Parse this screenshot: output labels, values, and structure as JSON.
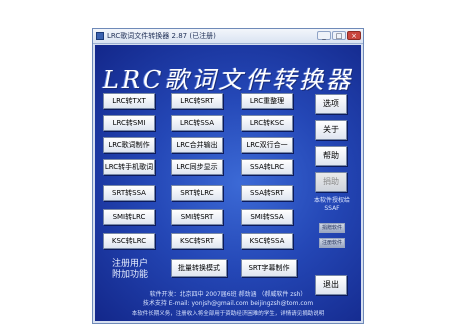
{
  "window": {
    "title": "LRC歌词文件转换器 2.87 (已注册)"
  },
  "logo_text": "LRC歌词文件转换器",
  "buttons": {
    "r1": [
      "LRC转TXT",
      "LRC转SRT",
      "LRC重整理"
    ],
    "r2": [
      "LRC转SMI",
      "LRC转SSA",
      "LRC转KSC"
    ],
    "r3": [
      "LRC歌词制作",
      "LRC合并输出",
      "LRC双行合一"
    ],
    "r4": [
      "LRC转手机歌词",
      "LRC同步显示",
      "SSA转LRC"
    ],
    "r5": [
      "SRT转SSA",
      "SRT转LRC",
      "SSA转SRT"
    ],
    "r6": [
      "SMI转LRC",
      "SMI转SRT",
      "SMI转SSA"
    ],
    "r7": [
      "KSC转LRC",
      "KSC转SRT",
      "KSC转SSA"
    ],
    "r8": [
      "批量转换模式",
      "SRT字幕制作"
    ]
  },
  "side": {
    "options": "选项",
    "about": "关于",
    "help": "帮助",
    "donate": "捐助",
    "exit": "退出"
  },
  "license": {
    "line1": "本软件授权给",
    "line2": "SSAF"
  },
  "tiny_buttons": [
    "捐赠软件",
    "注册软件"
  ],
  "register": {
    "line1": "注册用户",
    "line2": "附加功能"
  },
  "footer": {
    "line1": "软件开发：北京四中 2007届6班 郝劲涵 （郝威软件 zsh）",
    "line2": "技术支持 E-mail: yonjsh@gmail.com beijingzsh@tom.com",
    "line3": "本软件长期义务，注册收入将全部用于资助经济困难的学生，详情请见捐助说明"
  }
}
